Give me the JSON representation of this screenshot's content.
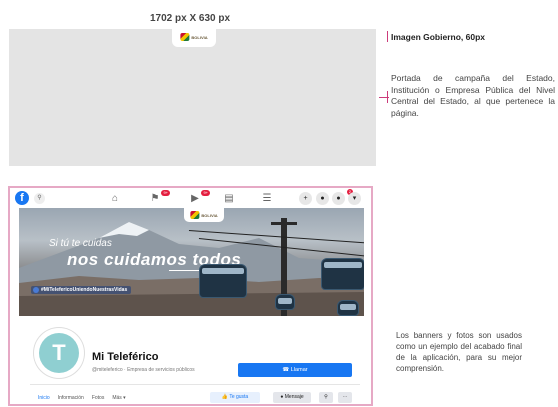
{
  "dimension_label": "1702 px X 630 px",
  "seal_text": "BOLIVIA",
  "right": {
    "label": "Imagen Gobierno, 60px",
    "description": "Portada de campaña del Estado, Institución o Empresa Pública del Nivel Central del Estado, al que pertenece la página."
  },
  "facebook": {
    "logo_letter": "f",
    "notifications": {
      "flag": "9+",
      "video": "9+",
      "bell": "2"
    },
    "cover": {
      "line1": "Si tú te cuidas",
      "line2": "nos cuidamos todos",
      "hashtag": "#MiTelefericoUniendoNuestrasVidas"
    },
    "page_name": "Mi Teleférico",
    "page_subtitle": "@miteleferico · Empresa de servicios públicos",
    "call_button": "Llamar",
    "tabs": [
      "Inicio",
      "Información",
      "Fotos",
      "Más ▾"
    ],
    "actions": {
      "like": "Te gusta",
      "message": "Mensaje"
    }
  },
  "bottom_description": "Los banners y fotos son usados como un ejemplo del acabado final de la aplicación, para su mejor comprensión.",
  "colors": {
    "facebook_blue": "#1877f2",
    "frame_pink": "#e6a9c5",
    "placeholder_gray": "#e4e4e4"
  }
}
